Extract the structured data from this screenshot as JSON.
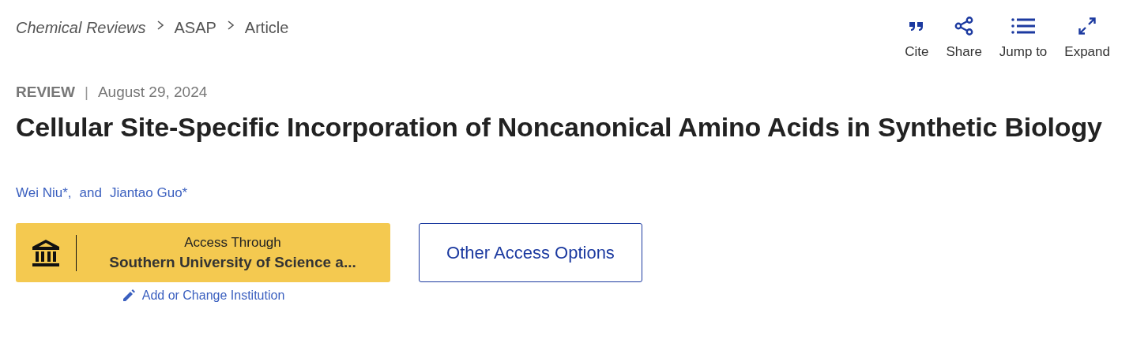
{
  "breadcrumb": [
    {
      "label": "Chemical Reviews",
      "kind": "journal"
    },
    {
      "label": "ASAP",
      "kind": "section"
    },
    {
      "label": "Article",
      "kind": "section"
    }
  ],
  "actions": [
    {
      "label": "Cite",
      "kind": "quote"
    },
    {
      "label": "Share",
      "kind": "share"
    },
    {
      "label": "Jump to",
      "kind": "list"
    },
    {
      "label": "Expand",
      "kind": "expand"
    }
  ],
  "article": {
    "type": "REVIEW",
    "separator": "|",
    "date": "August 29, 2024",
    "title": "Cellular Site-Specific Incorporation of Noncanonical Amino Acids in Synthetic Biology"
  },
  "authors": [
    "Wei Niu*,",
    "Jiantao Guo*"
  ],
  "author_conjunction": "and",
  "access": {
    "label": "Access Through",
    "institution": "Southern University of Science a...",
    "change_link": "Add or Change Institution",
    "other_button": "Other Access Options"
  }
}
